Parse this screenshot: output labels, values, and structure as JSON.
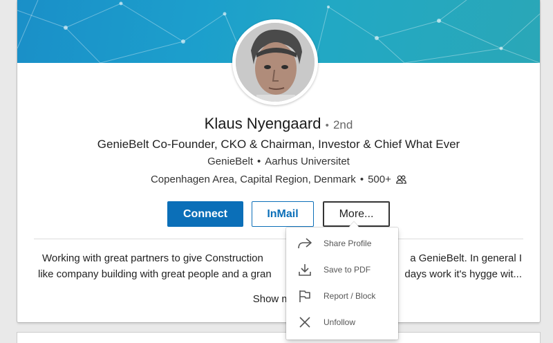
{
  "profile": {
    "name": "Klaus Nyengaard",
    "degree": "2nd",
    "headline": "GenieBelt Co-Founder, CKO & Chairman, Investor & Chief What Ever",
    "company": "GenieBelt",
    "school": "Aarhus Universitet",
    "location": "Copenhagen Area, Capital Region, Denmark",
    "connections": "500+"
  },
  "actions": {
    "connect_label": "Connect",
    "inmail_label": "InMail",
    "more_label": "More..."
  },
  "summary": {
    "line1_left": "Working with great partners to give Construction",
    "line1_right": "a GenieBelt. In general I",
    "line2_left": "like company building with great people and a gran",
    "line2_right": "days work it's hygge wit...",
    "show_more": "Show mo"
  },
  "more_menu": {
    "items": [
      {
        "label": "Share Profile",
        "icon": "share-icon"
      },
      {
        "label": "Save to PDF",
        "icon": "download-icon"
      },
      {
        "label": "Report / Block",
        "icon": "flag-icon"
      },
      {
        "label": "Unfollow",
        "icon": "close-icon"
      }
    ]
  },
  "colors": {
    "primary": "#0b6fb8",
    "banner_start": "#1a8fc8",
    "banner_end": "#2aa7b7"
  }
}
